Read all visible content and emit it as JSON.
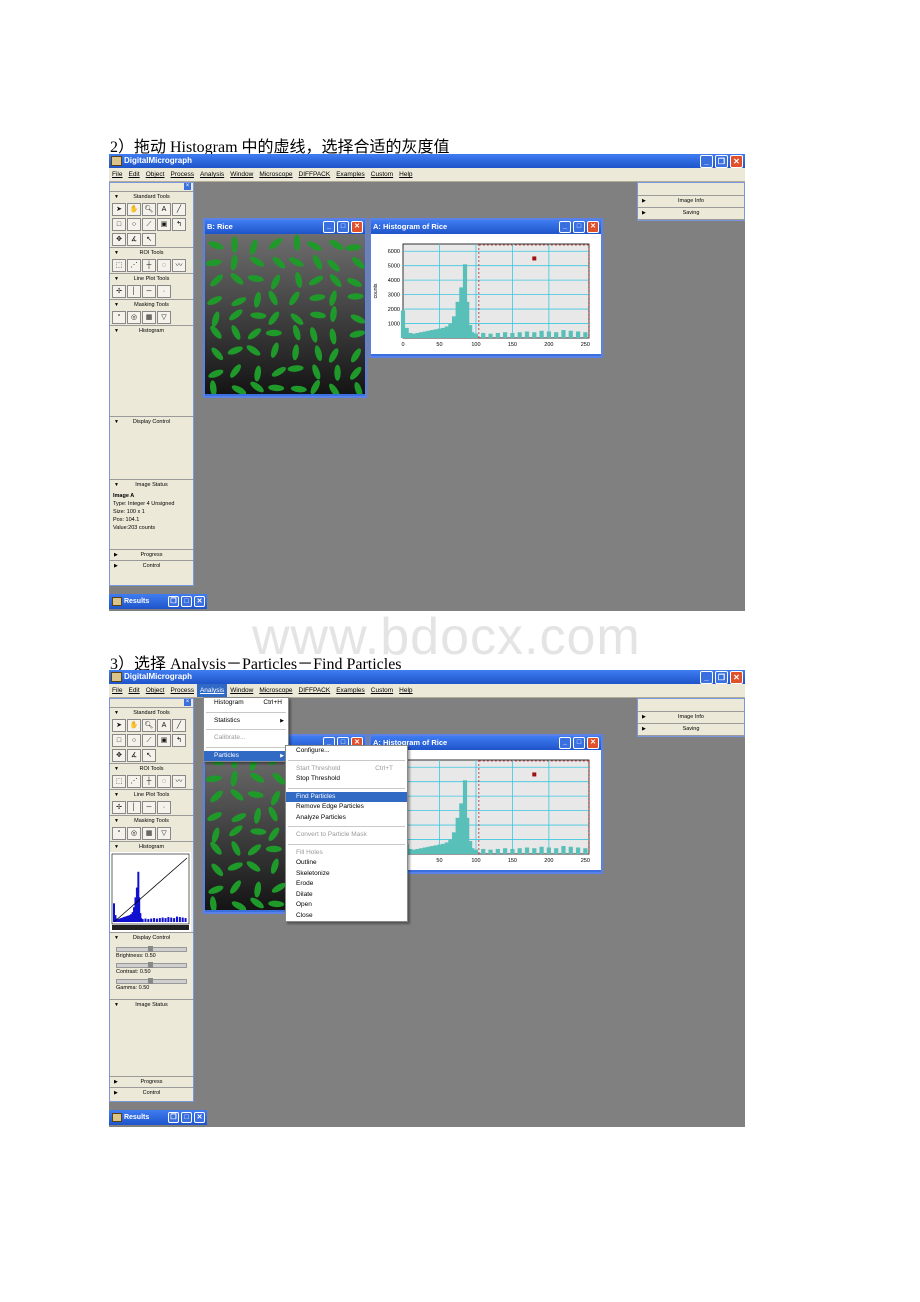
{
  "steps": {
    "step2_text": "2）拖动 Histogram 中的虚线，选择合适的灰度值",
    "step3_text": "3）选择 Analysis－Particles－Find Particles"
  },
  "watermark": "www.bdocx.com",
  "app": {
    "title": "DigitalMicrograph",
    "menus": [
      "File",
      "Edit",
      "Object",
      "Process",
      "Analysis",
      "Window",
      "Microscope",
      "DIFFPACK",
      "Examples",
      "Custom",
      "Help"
    ]
  },
  "tool_panel": {
    "sections": {
      "standard": "Standard Tools",
      "roi": "ROI Tools",
      "lineplot": "Line Plot Tools",
      "masking": "Masking Tools",
      "histogram": "Histogram",
      "display": "Display Control",
      "status": "Image Status",
      "progress": "Progress",
      "control": "Control"
    },
    "status_lines": [
      "Image A",
      "Type: Integer 4 Unsigned",
      "Size:  100 x 1",
      "Pos:   104.1",
      "Value:203 counts"
    ],
    "display_control": [
      "Brightness: 0.50",
      "Contrast: 0.50",
      "Gamma: 0.50"
    ]
  },
  "results_label": "Results",
  "windows": {
    "rice": "B: Rice",
    "histogram": "A: Histogram of Rice"
  },
  "right_panel": [
    "Image Info",
    "Saving"
  ],
  "histogram_axes": {
    "ylabel": "counts",
    "yticks": [
      "6000",
      "5000",
      "4000",
      "3000",
      "2000",
      "1000"
    ],
    "xticks": [
      "0",
      "50",
      "100",
      "150",
      "200",
      "250"
    ]
  },
  "analysis_menu": {
    "items": [
      "Histogram",
      "Statistics",
      "Calibrate...",
      "Particles"
    ],
    "histogram_shortcut": "Ctrl+H"
  },
  "particles_menu": {
    "configure": "Configure...",
    "start_threshold": "Start Threshold",
    "start_shortcut": "Ctrl+T",
    "stop_threshold": "Stop Threshold",
    "find": "Find Particles",
    "remove_edge": "Remove Edge Particles",
    "analyze": "Analyze Particles",
    "convert": "Convert to Particle Mask",
    "fill_holes": "Fill Holes",
    "morph": [
      "Outline",
      "Skeletonize",
      "Erode",
      "Dilate",
      "Open",
      "Close"
    ]
  },
  "chart_data": [
    {
      "type": "bar",
      "title": "A: Histogram of Rice",
      "xlabel": "",
      "ylabel": "counts",
      "xlim": [
        0,
        255
      ],
      "ylim": [
        0,
        6500
      ],
      "x": [
        0,
        5,
        10,
        15,
        20,
        25,
        30,
        35,
        40,
        45,
        50,
        55,
        60,
        65,
        70,
        75,
        80,
        85,
        88,
        92,
        95,
        100,
        110,
        120,
        130,
        140,
        150,
        160,
        170,
        180,
        190,
        200,
        210,
        220,
        230,
        240,
        250
      ],
      "values": [
        1900,
        700,
        350,
        300,
        350,
        400,
        450,
        500,
        550,
        600,
        650,
        700,
        800,
        1000,
        1500,
        2500,
        3500,
        5100,
        2500,
        900,
        400,
        300,
        350,
        300,
        350,
        400,
        350,
        400,
        450,
        400,
        500,
        450,
        400,
        550,
        500,
        450,
        400
      ],
      "threshold_lines": [
        104,
        255
      ]
    }
  ]
}
